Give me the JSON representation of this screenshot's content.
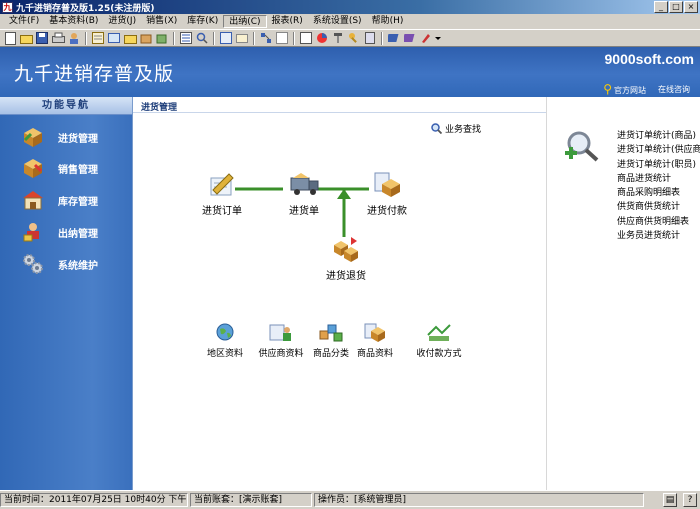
{
  "window": {
    "title": "九千进销存普及版1.25(未注册版)",
    "buttons": [
      "_",
      "□",
      "×"
    ]
  },
  "menubar": {
    "items": [
      "文件(F)",
      "基本资料(B)",
      "进货(J)",
      "销售(X)",
      "库存(K)",
      "出纳(C)",
      "报表(R)",
      "系统设置(S)",
      "帮助(H)"
    ],
    "active_index": 5
  },
  "banner": {
    "app_title": "九千进销存普及版",
    "site": "9000soft.com",
    "link_website": "官方网站",
    "link_online": "在线咨询"
  },
  "nav": {
    "header": "功能导航",
    "items": [
      {
        "label": "进货管理",
        "icon": "box-purchase-icon"
      },
      {
        "label": "销售管理",
        "icon": "box-sales-icon"
      },
      {
        "label": "库存管理",
        "icon": "warehouse-icon"
      },
      {
        "label": "出纳管理",
        "icon": "cashier-icon"
      },
      {
        "label": "系统维护",
        "icon": "gears-icon"
      }
    ]
  },
  "main": {
    "section_title": "进货管理",
    "search_link": "业务查找",
    "flow": {
      "order": "进货订单",
      "receipt": "进货单",
      "payment": "进货付款",
      "return": "进货退货"
    },
    "bottom_items": [
      "地区资料",
      "供应商资料",
      "商品分类",
      "商品资料",
      "收付款方式"
    ],
    "reports": [
      "进货订单统计(商品)",
      "进货订单统计(供应商)",
      "进货订单统计(职员)",
      "商品进货统计",
      "商品采购明细表",
      "供货商供货统计",
      "供应商供货明细表",
      "业务员进货统计"
    ]
  },
  "statusbar": {
    "time": "当前时间：2011年07月25日 10时40分 下午",
    "account": "当前账套：[演示账套]",
    "operator": "操作员：[系统管理员]"
  }
}
